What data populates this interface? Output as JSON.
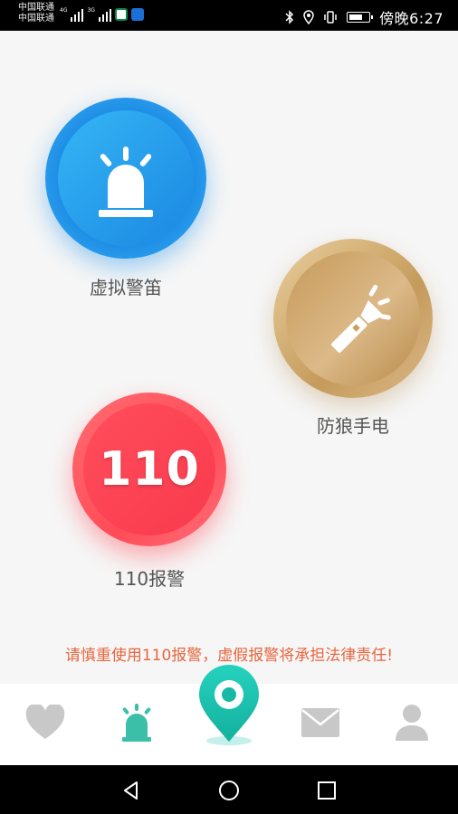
{
  "status_bar": {
    "carrier_1": "中国联通",
    "carrier_2": "中国联通",
    "net_1": "4G",
    "net_2": "3G",
    "time": "傍晚6:27"
  },
  "main": {
    "siren": {
      "label": "虚拟警笛",
      "icon": "siren-icon"
    },
    "flashlight": {
      "label": "防狼手电",
      "icon": "flashlight-icon"
    },
    "police": {
      "label": "110报警",
      "number": "110"
    },
    "warning": "请慎重使用110报警，虚假报警将承担法律责任!"
  },
  "tabbar": {
    "items": [
      {
        "icon": "heart-icon",
        "active": false
      },
      {
        "icon": "siren-icon",
        "active": true
      },
      {
        "icon": "location-pin-icon",
        "active": false
      },
      {
        "icon": "mail-icon",
        "active": false
      },
      {
        "icon": "user-icon",
        "active": false
      }
    ]
  },
  "colors": {
    "blue": "#1e8fe6",
    "gold": "#c99f62",
    "red": "#ff4b58",
    "teal": "#19c2ae",
    "warning": "#e8663e"
  }
}
